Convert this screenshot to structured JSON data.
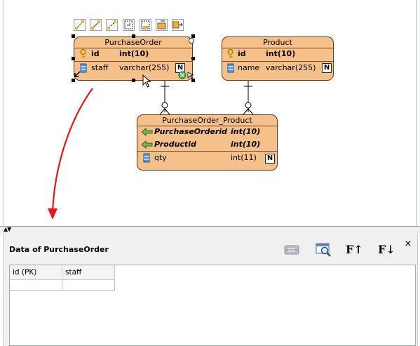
{
  "diagram": {
    "entities": [
      {
        "name": "PurchaseOrder",
        "columns": [
          {
            "name": "id",
            "type": "int(10)",
            "key": "primary"
          },
          {
            "name": "staff",
            "type": "varchar(255)",
            "nullable_badge": "N"
          }
        ]
      },
      {
        "name": "Product",
        "columns": [
          {
            "name": "id",
            "type": "int(10)",
            "key": "primary"
          },
          {
            "name": "name",
            "type": "varchar(255)",
            "nullable_badge": "N"
          }
        ]
      },
      {
        "name": "PurchaseOrder_Product",
        "columns": [
          {
            "name": "PurchaseOrderid",
            "type": "int(10)",
            "key": "foreign"
          },
          {
            "name": "Productid",
            "type": "int(10)",
            "key": "foreign"
          },
          {
            "name": "qty",
            "type": "int(11)",
            "nullable_badge": "N"
          }
        ]
      }
    ],
    "selected_entity": "PurchaseOrder",
    "annotation_arrow_color": "#e8141b",
    "entity_fill_color": "#f6c08a"
  },
  "data_panel": {
    "title": "Data of PurchaseOrder",
    "tools": [
      "db-column-icon",
      "zoom-search-icon",
      "font-increase-icon",
      "font-decrease-icon"
    ],
    "tool_glyphs": {
      "font_up": "F↑",
      "font_down": "F↓"
    },
    "close_glyph": "×",
    "columns": [
      "id (PK)",
      "staff"
    ],
    "rows": [
      [
        "",
        ""
      ]
    ]
  },
  "splitter": {
    "glyph": "▲▼"
  }
}
